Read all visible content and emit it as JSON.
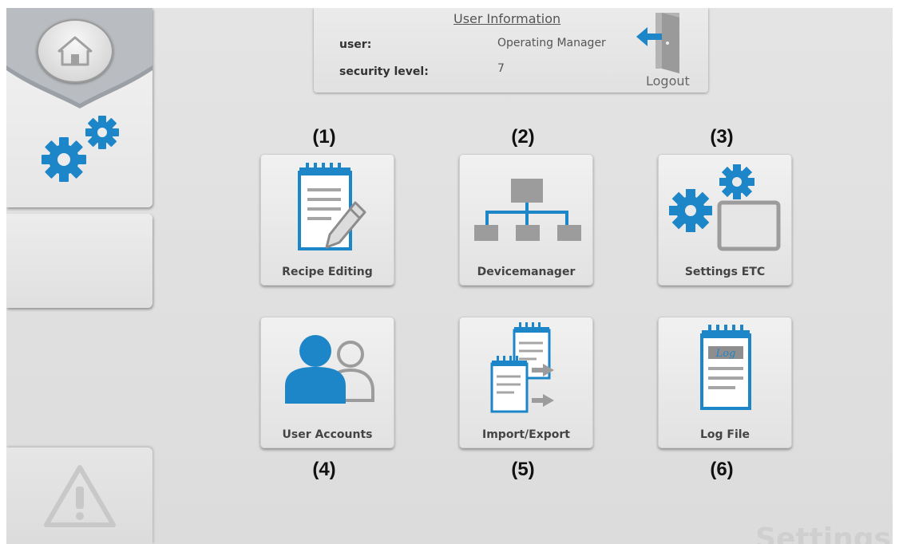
{
  "user_info": {
    "title": "User Information",
    "user_label": "user:",
    "user_value": "Operating Manager",
    "security_label": "security level:",
    "security_value": "7",
    "logout_label": "Logout"
  },
  "sidebar": {
    "home_icon": "home-icon",
    "active_icon": "settings-gears-icon",
    "alarm_icon": "warning-triangle-icon"
  },
  "tiles": [
    {
      "number": "(1)",
      "label": "Recipe Editing",
      "icon": "recipe-notepad-icon"
    },
    {
      "number": "(2)",
      "label": "Devicemanager",
      "icon": "device-tree-icon"
    },
    {
      "number": "(3)",
      "label": "Settings ETC",
      "icon": "settings-monitor-icon"
    },
    {
      "number": "(4)",
      "label": "User Accounts",
      "icon": "user-accounts-icon"
    },
    {
      "number": "(5)",
      "label": "Import/Export",
      "icon": "import-export-icon"
    },
    {
      "number": "(6)",
      "label": "Log File",
      "icon": "log-file-icon",
      "icon_text": "Log"
    }
  ],
  "page_watermark": "Settings",
  "colors": {
    "accent_blue": "#1d86c8",
    "icon_gray": "#9c9c9c",
    "background": "#e0e0e0"
  }
}
